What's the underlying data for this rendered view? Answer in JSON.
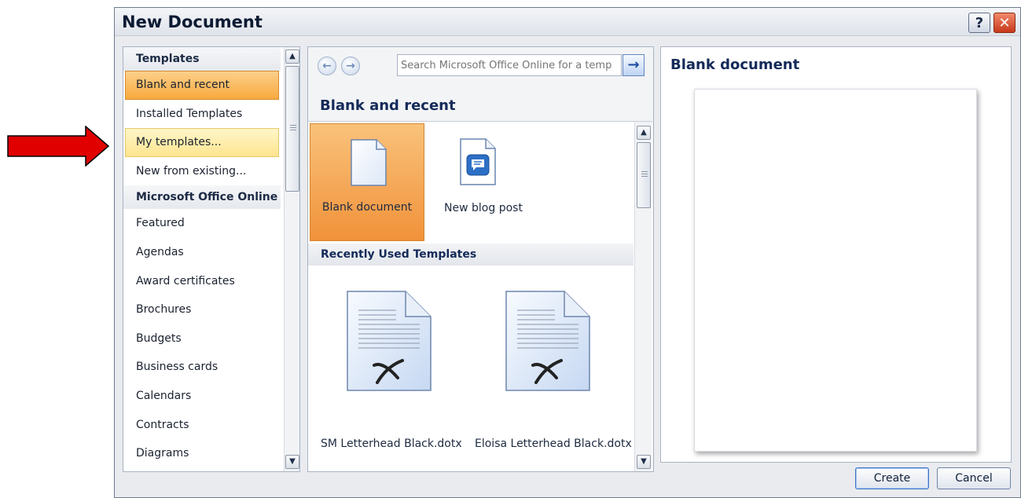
{
  "dialog": {
    "title": "New Document",
    "help_label": "?",
    "close_label": "✕"
  },
  "sidebar": {
    "header": "Templates",
    "items": [
      {
        "label": "Blank and recent",
        "state": "selected"
      },
      {
        "label": "Installed Templates",
        "state": "normal"
      },
      {
        "label": "My templates...",
        "state": "hover"
      },
      {
        "label": "New from existing...",
        "state": "normal"
      }
    ],
    "online_header": "Microsoft Office Online",
    "online_items": [
      "Featured",
      "Agendas",
      "Award certificates",
      "Brochures",
      "Budgets",
      "Business cards",
      "Calendars",
      "Contracts",
      "Diagrams"
    ]
  },
  "middle": {
    "search_placeholder": "Search Microsoft Office Online for a temp",
    "section_title": "Blank and recent",
    "tiles": [
      {
        "label": "Blank document",
        "icon": "blank-document-icon",
        "selected": true
      },
      {
        "label": "New blog post",
        "icon": "blog-post-icon",
        "selected": false
      }
    ],
    "recent_header": "Recently Used Templates",
    "recent": [
      {
        "label": "SM Letterhead Black.dotx",
        "icon": "template-file-icon"
      },
      {
        "label": "Eloisa Letterhead Black.dotx",
        "icon": "template-file-icon"
      }
    ]
  },
  "preview": {
    "title": "Blank document"
  },
  "buttons": {
    "create": "Create",
    "cancel": "Cancel"
  },
  "colors": {
    "selected_orange": "#f1923a",
    "hover_yellow": "#fde58f",
    "heading_blue": "#142a58",
    "annotation_arrow": "#e00000"
  }
}
